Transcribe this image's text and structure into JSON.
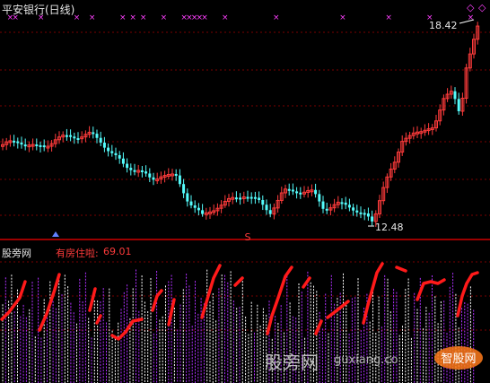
{
  "title": "平安银行(日线)",
  "price_high_label": "18.42",
  "price_low_label": "12.48",
  "signal_marker": "S",
  "indicator": {
    "source_name": "股旁网",
    "label": "有房住啦:",
    "value": "69.01"
  },
  "watermark": {
    "text": "股旁网",
    "url": "guxiang.co",
    "logo_text": "智股网"
  },
  "colors": {
    "up": "#ff3b3b",
    "down": "#54fcfc",
    "grid": "#7a0000",
    "cross": "#ff40ff",
    "up_bar": "#ffffff",
    "down_bar": "#b030ff",
    "trend": "#ff1a1a",
    "separator": "#d00000"
  },
  "chart_data": {
    "type": "candlestick",
    "y_range": [
      12.48,
      18.42
    ],
    "cross_markers": [
      2,
      3,
      8,
      15,
      18,
      24,
      26,
      28,
      32,
      36,
      37,
      38,
      39,
      40,
      44,
      54,
      67,
      76,
      84,
      92
    ]
  }
}
